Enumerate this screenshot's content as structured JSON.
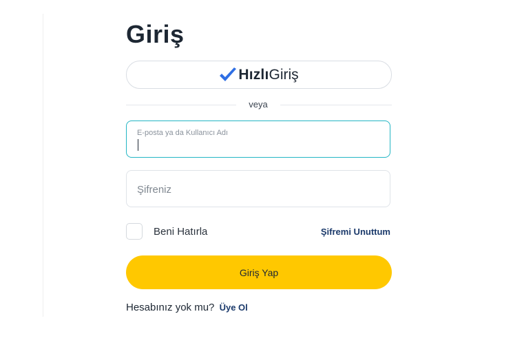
{
  "login": {
    "title": "Giriş",
    "quick_login": {
      "brand_bold": "Hızlı",
      "brand_light": "Giriş",
      "icon": "checkmark-icon",
      "icon_color": "#2f6fe4"
    },
    "separator_text": "veya",
    "email_field": {
      "label": "E-posta ya da Kullanıcı Adı",
      "value": ""
    },
    "password_field": {
      "placeholder": "Şifreniz",
      "value": ""
    },
    "remember_me": {
      "label": "Beni Hatırla",
      "checked": false
    },
    "forgot_password": "Şifremi Unuttum",
    "submit_label": "Giriş Yap",
    "signup_prompt": "Hesabınız yok mu?",
    "signup_link": "Üye Ol"
  },
  "colors": {
    "accent_yellow": "#ffc800",
    "focus_border": "#22b5c4",
    "link_blue": "#1b3a6b",
    "text_dark": "#1d2733"
  }
}
